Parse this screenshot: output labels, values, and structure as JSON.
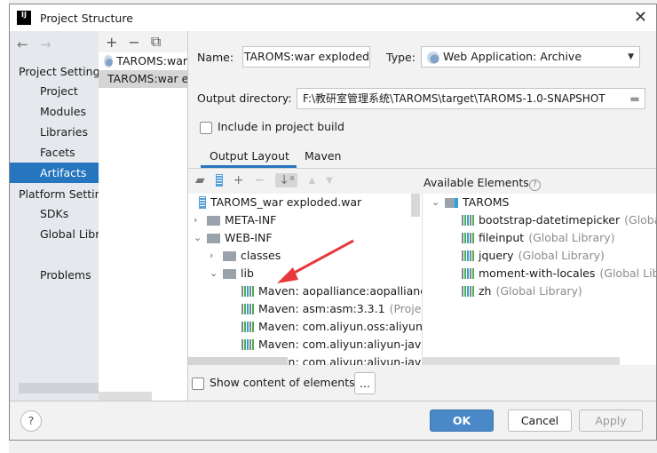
{
  "window": {
    "title": "Project Structure",
    "close_icon": "close-icon"
  },
  "nav": {
    "sections": [
      {
        "header": "Project Settings",
        "items": [
          "Project",
          "Modules",
          "Libraries",
          "Facets",
          "Artifacts"
        ]
      },
      {
        "header": "Platform Settings",
        "items": [
          "SDKs",
          "Global Libraries"
        ]
      }
    ],
    "problems": "Problems",
    "selected": "Artifacts"
  },
  "artifacts": {
    "items": [
      "TAROMS:war",
      "TAROMS:war exploded"
    ],
    "selected": 1
  },
  "form": {
    "name_label": "Name:",
    "name_value": "TAROMS:war exploded",
    "type_label": "Type:",
    "type_value": "Web Application: Archive",
    "outdir_label": "Output directory:",
    "outdir_value": "F:\\教研室管理系统\\TAROMS\\target\\TAROMS-1.0-SNAPSHOT",
    "include_label": "Include in project build",
    "include_checked": false
  },
  "tabs": [
    "Output Layout",
    "Maven"
  ],
  "active_tab": "Output Layout",
  "tree": {
    "root": "TAROMS_war exploded.war",
    "items": [
      {
        "label": "META-INF",
        "level": 1,
        "expanded": false
      },
      {
        "label": "WEB-INF",
        "level": 1,
        "expanded": true
      },
      {
        "label": "classes",
        "level": 2,
        "expanded": false
      },
      {
        "label": "lib",
        "level": 2,
        "expanded": true
      },
      {
        "label": "Maven: aopalliance:aopalliance:",
        "suffix": ""
      },
      {
        "label": "Maven: asm:asm:3.3.1",
        "suffix": "(Project Library)"
      },
      {
        "label": "Maven: com.aliyun.oss:aliyun-sdk-oss",
        "suffix": ""
      },
      {
        "label": "Maven: com.aliyun:aliyun-java-sdk-core",
        "suffix": ""
      },
      {
        "label": "Maven: com.aliyun:aliyun-java-sdk",
        "suffix": ""
      }
    ]
  },
  "available": {
    "title": "Available Elements",
    "module": "TAROMS",
    "items": [
      {
        "name": "bootstrap-datetimepicker",
        "scope": "(Global Library)"
      },
      {
        "name": "fileinput",
        "scope": "(Global Library)"
      },
      {
        "name": "jquery",
        "scope": "(Global Library)"
      },
      {
        "name": "moment-with-locales",
        "scope": "(Global Library)"
      },
      {
        "name": "zh",
        "scope": "(Global Library)"
      }
    ]
  },
  "show_content_label": "Show content of elements",
  "show_content_checked": false,
  "ellipsis": "...",
  "buttons": {
    "ok": "OK",
    "cancel": "Cancel",
    "apply": "Apply",
    "help": "?"
  },
  "colors": {
    "accent": "#2675bf",
    "ok": "#4a88c7",
    "arrow": "#e8383d"
  }
}
